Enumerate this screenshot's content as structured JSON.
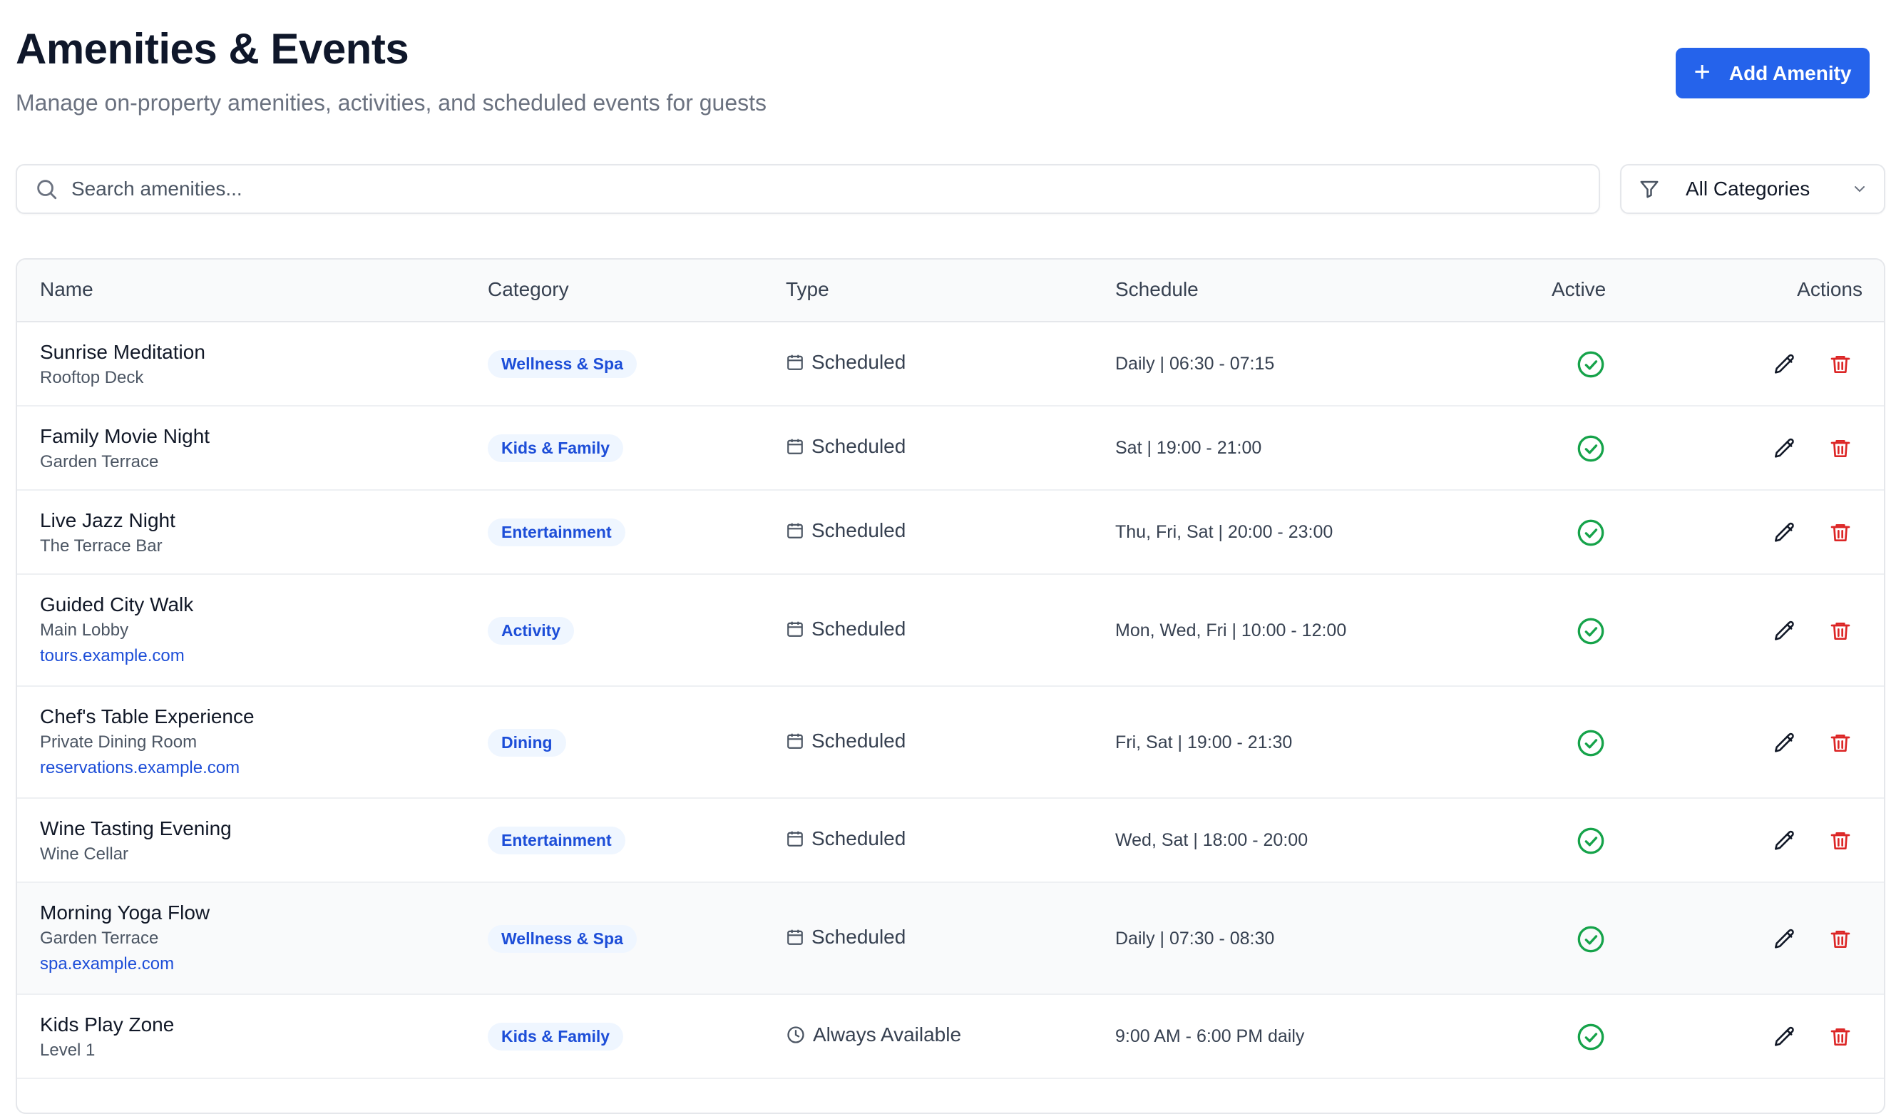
{
  "header": {
    "title": "Amenities & Events",
    "subtitle": "Manage on-property amenities, activities, and scheduled events for guests",
    "add_button_label": "Add Amenity"
  },
  "search": {
    "placeholder": "Search amenities...",
    "value": ""
  },
  "filter": {
    "selected": "All Categories"
  },
  "table": {
    "columns": [
      "Name",
      "Category",
      "Type",
      "Schedule",
      "Active",
      "Actions"
    ],
    "rows": [
      {
        "name": "Sunrise Meditation",
        "location": "Rooftop Deck",
        "link": "",
        "category": "Wellness & Spa",
        "type": "Scheduled",
        "type_icon": "calendar-icon",
        "schedule": "Daily | 06:30 - 07:15",
        "active": true
      },
      {
        "name": "Family Movie Night",
        "location": "Garden Terrace",
        "link": "",
        "category": "Kids & Family",
        "type": "Scheduled",
        "type_icon": "calendar-icon",
        "schedule": "Sat | 19:00 - 21:00",
        "active": true
      },
      {
        "name": "Live Jazz Night",
        "location": "The Terrace Bar",
        "link": "",
        "category": "Entertainment",
        "type": "Scheduled",
        "type_icon": "calendar-icon",
        "schedule": "Thu, Fri, Sat | 20:00 - 23:00",
        "active": true
      },
      {
        "name": "Guided City Walk",
        "location": "Main Lobby",
        "link": "tours.example.com",
        "category": "Activity",
        "type": "Scheduled",
        "type_icon": "calendar-icon",
        "schedule": "Mon, Wed, Fri | 10:00 - 12:00",
        "active": true
      },
      {
        "name": "Chef's Table Experience",
        "location": "Private Dining Room",
        "link": "reservations.example.com",
        "category": "Dining",
        "type": "Scheduled",
        "type_icon": "calendar-icon",
        "schedule": "Fri, Sat | 19:00 - 21:30",
        "active": true
      },
      {
        "name": "Wine Tasting Evening",
        "location": "Wine Cellar",
        "link": "",
        "category": "Entertainment",
        "type": "Scheduled",
        "type_icon": "calendar-icon",
        "schedule": "Wed, Sat | 18:00 - 20:00",
        "active": true
      },
      {
        "name": "Morning Yoga Flow",
        "location": "Garden Terrace",
        "link": "spa.example.com",
        "category": "Wellness & Spa",
        "type": "Scheduled",
        "type_icon": "calendar-icon",
        "schedule": "Daily | 07:30 - 08:30",
        "active": true
      },
      {
        "name": "Kids Play Zone",
        "location": "Level 1",
        "link": "",
        "category": "Kids & Family",
        "type": "Always Available",
        "type_icon": "clock-icon",
        "schedule": "9:00 AM - 6:00 PM daily",
        "active": true
      }
    ]
  },
  "colors": {
    "primary": "#2563eb",
    "badge_bg": "#eff6ff",
    "badge_text": "#1d4ed8",
    "active_green": "#16a34a",
    "delete_red": "#dc2626"
  }
}
